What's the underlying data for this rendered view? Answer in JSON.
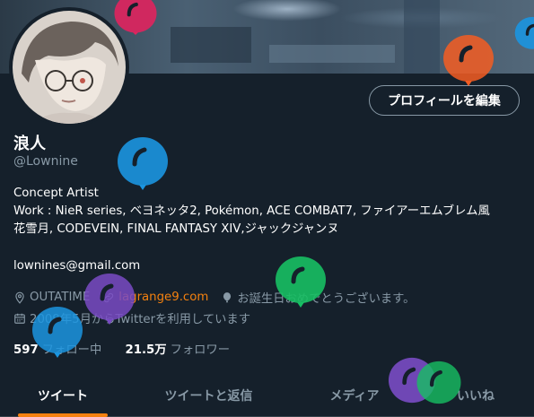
{
  "profile": {
    "name": "浪人",
    "handle": "@Lownine",
    "edit_button": "プロフィールを編集",
    "bio_lines": [
      "Concept Artist",
      "Work : NieR series, ベヨネッタ2, Pokémon, ACE COMBAT7, ファイアーエムブレム風",
      "花雪月, CODEVEIN, FINAL FANTASY XIV,ジャックジャンヌ"
    ],
    "email": "lownines@gmail.com",
    "location": "OUTATIME",
    "website": "lagrange9.com",
    "birthday_text": "お誕生日おめでとうございます。",
    "joined": "2009年5月からTwitterを利用しています",
    "following_count": "597",
    "following_label": "フォロー中",
    "followers_count": "21.5万",
    "followers_label": "フォロワー"
  },
  "tabs": [
    {
      "label": "ツイート",
      "active": true
    },
    {
      "label": "ツイートと返信",
      "active": false
    },
    {
      "label": "メディア",
      "active": false
    },
    {
      "label": "いいね",
      "active": false
    }
  ],
  "icons": {
    "location": "location-pin-icon",
    "link": "link-icon",
    "birthday": "balloon-icon",
    "joined": "calendar-icon"
  },
  "colors": {
    "background": "#15202b",
    "accent": "#f4810f",
    "muted": "#8899a6",
    "balloon_pink": "#e0245e",
    "balloon_blue": "#1b95e0",
    "balloon_purple": "#794bc4",
    "balloon_green": "#17bf63",
    "balloon_orange": "#f45d22"
  }
}
